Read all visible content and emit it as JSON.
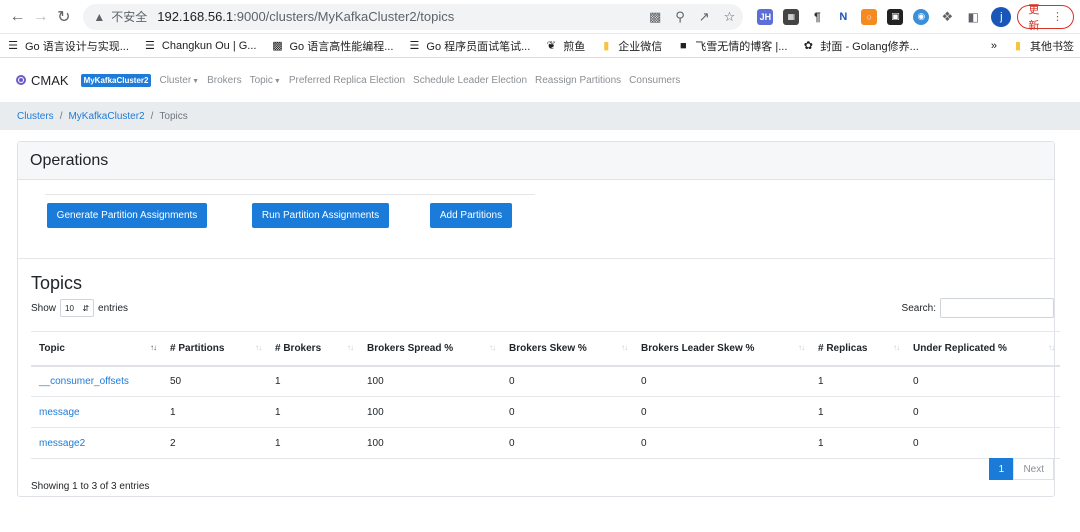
{
  "browser": {
    "insecure_label": "不安全",
    "url_host": "192.168.56.1",
    "url_path": ":9000/clusters/MyKafkaCluster2/topics",
    "update_label": "更新",
    "profile_initial": "j"
  },
  "bookmarks": {
    "items": [
      {
        "label": "Go 语言设计与实现...",
        "icon": "lines-icon"
      },
      {
        "label": "Changkun Ou | G...",
        "icon": "lines-icon"
      },
      {
        "label": "Go 语言高性能编程...",
        "icon": "image-icon"
      },
      {
        "label": "Go 程序员面试笔试...",
        "icon": "lines-icon"
      },
      {
        "label": "煎鱼",
        "icon": "fish-icon"
      },
      {
        "label": "企业微信",
        "icon": "folder-icon"
      },
      {
        "label": "飞雪无情的博客 |...",
        "icon": "avatar-icon"
      },
      {
        "label": "封面 - Golang修养...",
        "icon": "leaf-icon"
      }
    ],
    "more_label": "»",
    "other_label": "其他书签"
  },
  "app_nav": {
    "brand": "CMAK",
    "cluster_badge": "MyKafkaCluster2",
    "links": [
      "Cluster",
      "Brokers",
      "Topic",
      "Preferred Replica Election",
      "Schedule Leader Election",
      "Reassign Partitions",
      "Consumers"
    ]
  },
  "breadcrumb": {
    "items": [
      "Clusters",
      "MyKafkaCluster2",
      "Topics"
    ],
    "separator": "/"
  },
  "operations": {
    "title": "Operations",
    "buttons": [
      "Generate Partition Assignments",
      "Run Partition Assignments",
      "Add Partitions"
    ]
  },
  "topics": {
    "title": "Topics",
    "show_label": "Show",
    "entries_value": "10",
    "entries_label": "entries",
    "search_label": "Search:",
    "columns": [
      "Topic",
      "# Partitions",
      "# Brokers",
      "Brokers Spread %",
      "Brokers Skew %",
      "Brokers Leader Skew %",
      "# Replicas",
      "Under Replicated %"
    ],
    "rows": [
      [
        "__consumer_offsets",
        "50",
        "1",
        "100",
        "0",
        "0",
        "1",
        "0"
      ],
      [
        "message",
        "1",
        "1",
        "100",
        "0",
        "0",
        "1",
        "0"
      ],
      [
        "message2",
        "2",
        "1",
        "100",
        "0",
        "0",
        "1",
        "0"
      ]
    ],
    "info": "Showing 1 to 3 of 3 entries",
    "current_page": "1",
    "next_label": "Next"
  }
}
